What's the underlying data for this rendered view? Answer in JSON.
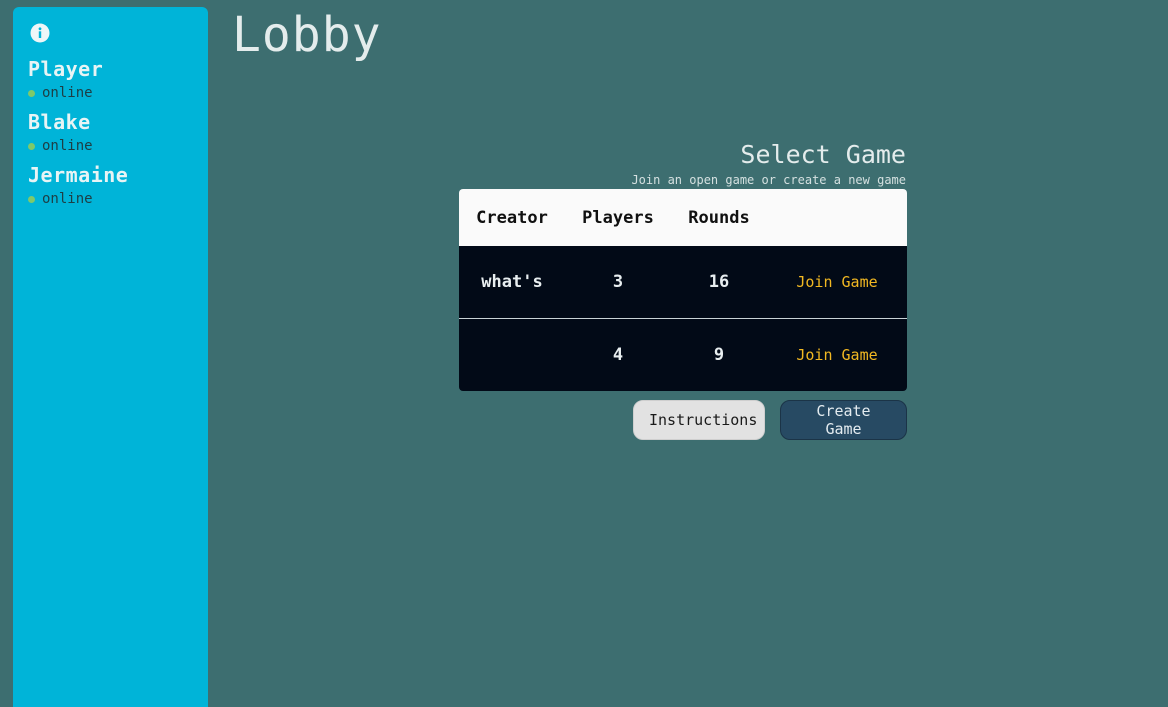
{
  "sidebar": {
    "info_icon": "info-icon",
    "players": [
      {
        "name": "Player",
        "status": "online"
      },
      {
        "name": "Blake",
        "status": "online"
      },
      {
        "name": "Jermaine",
        "status": "online"
      }
    ]
  },
  "page": {
    "title": "Lobby"
  },
  "select_game": {
    "title": "Select Game",
    "subtitle": "Join an open game or create a new game",
    "columns": [
      "Creator",
      "Players",
      "Rounds"
    ],
    "rows": [
      {
        "creator": "what's",
        "players": "3",
        "rounds": "16",
        "action": "Join Game"
      },
      {
        "creator": "",
        "players": "4",
        "rounds": "9",
        "action": "Join Game"
      }
    ]
  },
  "buttons": {
    "instructions": "Instructions",
    "create": "Create Game"
  },
  "colors": {
    "background": "#3d6e70",
    "sidebar": "#00b4d8",
    "row_bg": "#020a17",
    "join_link": "#f2b822",
    "online_dot": "#7fc96a",
    "create_button": "#274a63"
  }
}
